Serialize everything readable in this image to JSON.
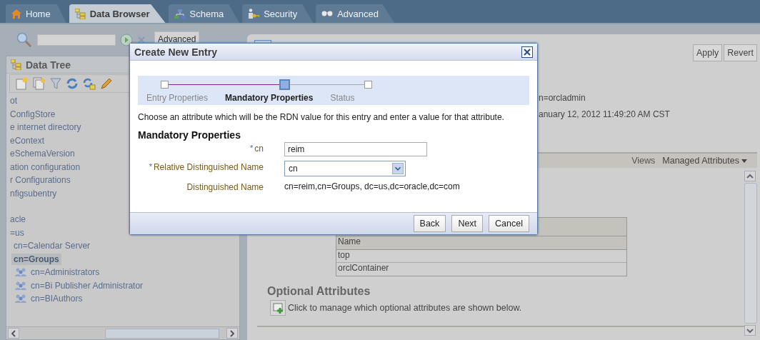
{
  "tabs": [
    {
      "label": "Home",
      "selected": false
    },
    {
      "label": "Data Browser",
      "selected": true
    },
    {
      "label": "Schema",
      "selected": false
    },
    {
      "label": "Security",
      "selected": false
    },
    {
      "label": "Advanced",
      "selected": false
    }
  ],
  "search": {
    "advanced_button": "Advanced"
  },
  "data_tree": {
    "title": "Data Tree",
    "sections": [
      {
        "items": [
          {
            "label": "ot",
            "kind": "entry",
            "selected": false
          },
          {
            "label": "ConfigStore",
            "kind": "entry",
            "selected": false
          },
          {
            "label": "e internet directory",
            "kind": "entry",
            "selected": false
          },
          {
            "label": "eContext",
            "kind": "entry",
            "selected": false
          },
          {
            "label": "eSchemaVersion",
            "kind": "entry",
            "selected": false
          },
          {
            "label": "ation configuration",
            "kind": "entry",
            "selected": false
          },
          {
            "label": "r Configurations",
            "kind": "entry",
            "selected": false
          },
          {
            "label": "nfigsubentry",
            "kind": "entry",
            "selected": false
          }
        ]
      },
      {
        "items": [
          {
            "label": "acle",
            "kind": "entry",
            "selected": false
          },
          {
            "label": "=us",
            "kind": "entry",
            "selected": false,
            "children": [
              {
                "label": "cn=Calendar Server",
                "kind": "entry",
                "selected": false
              },
              {
                "label": "cn=Groups",
                "kind": "entry",
                "selected": true,
                "children": [
                  {
                    "label": "cn=Administrators",
                    "kind": "group",
                    "selected": false
                  },
                  {
                    "label": "cn=Bi Publisher Administrator",
                    "kind": "group",
                    "selected": false
                  },
                  {
                    "label": "cn=BIAuthors",
                    "kind": "group",
                    "selected": false
                  }
                ]
              }
            ]
          }
        ]
      }
    ]
  },
  "detail": {
    "buttons": [
      "Apply",
      "Revert"
    ],
    "info_lines": [
      "n=orcladmin",
      "anuary 12, 2012 11:49:20 AM CST"
    ],
    "toolbar": {
      "views": "Views",
      "menu": "Managed Attributes"
    },
    "table": {
      "columns": [
        "Name"
      ],
      "rows": [
        "top",
        "orclContainer"
      ]
    },
    "optional": {
      "title": "Optional Attributes",
      "hint": "Click to manage which optional attributes are shown below."
    }
  },
  "dialog": {
    "title": "Create New Entry",
    "steps": [
      {
        "label": "Entry Properties",
        "selected": false
      },
      {
        "label": "Mandatory Properties",
        "selected": true
      },
      {
        "label": "Status",
        "selected": false
      }
    ],
    "instruction": "Choose an attribute which will be the RDN value for this entry and enter a value for that attribute.",
    "section": "Mandatory Properties",
    "fields": [
      {
        "kind": "text",
        "marker": "*",
        "label": "cn",
        "value": "reim"
      },
      {
        "kind": "select",
        "marker": "*",
        "label": "Relative Distinguished Name",
        "value": "cn"
      },
      {
        "kind": "static",
        "label": "Distinguished Name",
        "value": "cn=reim,cn=Groups, dc=us,dc=oracle,dc=com"
      }
    ],
    "buttons": [
      "Back",
      "Next",
      "Cancel"
    ]
  }
}
